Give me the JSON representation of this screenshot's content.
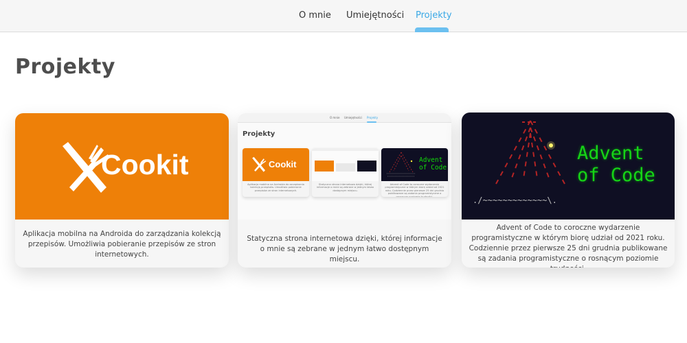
{
  "nav": {
    "items": [
      {
        "label": "O mnie"
      },
      {
        "label": "Umiejętności"
      },
      {
        "label": "Projekty",
        "active": true
      }
    ]
  },
  "page": {
    "title": "Projekty"
  },
  "cards": [
    {
      "logo_text": "Cookit",
      "description": "Aplikacja mobilna na Androida do zarządzania kolekcją przepisów. Umożliwia pobieranie przepisów ze stron internetowych."
    },
    {
      "description": "Statyczna strona internetowa dzięki, której informacje o mnie są zebrane w jednym łatwo dostępnym miejscu."
    },
    {
      "logo_text": "Advent of Code",
      "logo_lines": [
        "Advent",
        "of Code"
      ],
      "ascii_lines": [
        "./~~~~~~~~~~~~~\\.",
        "( .\",^. -\". '.~ )",
        " '~~~~~~~~~~~~~~~'"
      ],
      "description": "Advent of Code to coroczne wydarzenie programistyczne w którym biorę udział od 2021 roku. Codziennie przez pierwsze 25 dni grudnia publikowane są zadania programistyczne o rosnącym poziomie trudności."
    }
  ],
  "colors": {
    "accent": "#3aa8e6",
    "cookit_orange": "#ee8008",
    "aoc_background": "#0f0f23",
    "aoc_green": "#16d416"
  }
}
